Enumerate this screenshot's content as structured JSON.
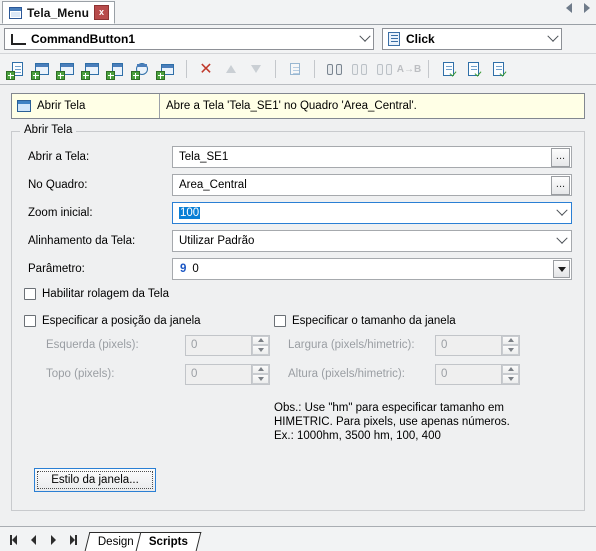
{
  "document_tab": {
    "title": "Tela_Menu",
    "close_label": "x",
    "icon": "window-icon"
  },
  "tabstrip_nav": {
    "prev": "◀",
    "next": "▶"
  },
  "selectors": {
    "object": {
      "value": "CommandButton1",
      "icon": "command-button-icon"
    },
    "event": {
      "value": "Click",
      "icon": "script-event-icon"
    }
  },
  "toolbar": {
    "buttons": [
      {
        "name": "new-script-icon",
        "enabled": true
      },
      {
        "name": "new-screen-icon",
        "enabled": true
      },
      {
        "name": "new-window-icon",
        "enabled": true
      },
      {
        "name": "new-frame-icon",
        "enabled": true
      },
      {
        "name": "new-download-icon",
        "enabled": true
      },
      {
        "name": "new-timer-icon",
        "enabled": true
      },
      {
        "name": "new-print-icon",
        "enabled": true
      },
      {
        "name": "delete-icon",
        "enabled": true
      },
      {
        "name": "move-up-icon",
        "enabled": false
      },
      {
        "name": "move-down-icon",
        "enabled": false
      },
      {
        "name": "branch-icon",
        "enabled": false
      },
      {
        "name": "find-icon",
        "enabled": false
      },
      {
        "name": "find-previous-icon",
        "enabled": false
      },
      {
        "name": "find-next-icon",
        "enabled": false
      },
      {
        "name": "replace-icon",
        "enabled": false
      },
      {
        "name": "validate-script-icon",
        "enabled": true
      },
      {
        "name": "validate-all-icon",
        "enabled": true
      },
      {
        "name": "validate-project-icon",
        "enabled": true
      }
    ]
  },
  "action_list": {
    "action_name": "Abrir Tela",
    "description": "Abre a Tela 'Tela_SE1' no Quadro 'Area_Central'.",
    "icon": "open-screen-icon"
  },
  "group": {
    "title": "Abrir Tela",
    "fields": [
      {
        "label": "Abrir a Tela:",
        "value": "Tela_SE1",
        "control": "text-ellipsis"
      },
      {
        "label": "No Quadro:",
        "value": "Area_Central",
        "control": "text-ellipsis"
      },
      {
        "label": "Zoom inicial:",
        "value": "100",
        "control": "combo",
        "selected": true
      },
      {
        "label": "Alinhamento da Tela:",
        "value": "Utilizar Padrão",
        "control": "combo"
      },
      {
        "label": "Parâmetro:",
        "value": "0",
        "marker": "9",
        "control": "dropdown"
      }
    ],
    "ellipsis_label": "...",
    "checkbox_scroll": {
      "label": "Habilitar rolagem da Tela",
      "checked": false
    },
    "checkbox_position": {
      "label": "Especificar a posição da janela",
      "checked": false
    },
    "checkbox_size": {
      "label": "Especificar o tamanho da janela",
      "checked": false
    },
    "position_fields": [
      {
        "label": "Esquerda (pixels):",
        "value": "0"
      },
      {
        "label": "Topo (pixels):",
        "value": "0"
      }
    ],
    "size_fields": [
      {
        "label": "Largura (pixels/himetric):",
        "value": "0"
      },
      {
        "label": "Altura (pixels/himetric):",
        "value": "0"
      }
    ],
    "note_line1": "Obs.: Use \"hm\" para especificar tamanho em",
    "note_line2": "HIMETRIC. Para pixels, use apenas números.",
    "note_line3": "Ex.: 1000hm, 3500 hm, 100, 400",
    "style_button": "Estilo da janela..."
  },
  "bottom_tabs": {
    "nav": {
      "first": "|◀",
      "prev": "◀",
      "next": "▶",
      "last": "▶|"
    },
    "tabs": [
      {
        "label": "Design",
        "active": false
      },
      {
        "label": "Scripts",
        "active": true
      }
    ]
  },
  "colors": {
    "accent": "#2a7fd4",
    "selection": "#0a7fd6",
    "list_bg": "#ffffe6",
    "panel_bg": "#eff0f1",
    "delete_red": "#c0392b",
    "param_blue": "#1a56c4"
  }
}
